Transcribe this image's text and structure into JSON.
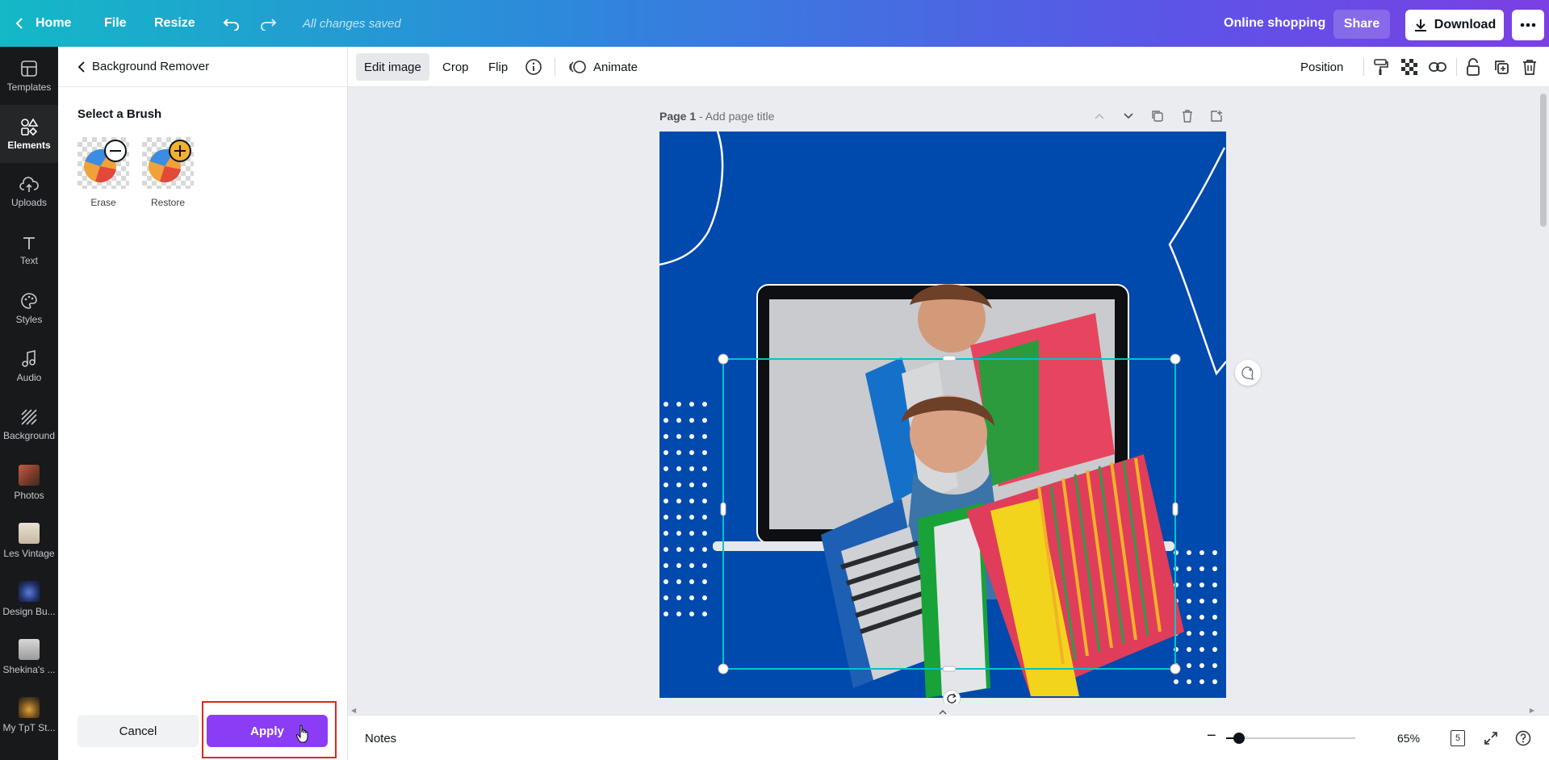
{
  "topbar": {
    "home_label": "Home",
    "file_label": "File",
    "resize_label": "Resize",
    "status": "All changes saved",
    "project_title": "Online shopping",
    "share_label": "Share",
    "download_label": "Download",
    "icons": [
      "chevron-left-icon",
      "undo-icon",
      "redo-icon",
      "download-icon",
      "more-icon"
    ],
    "gradient_colors": [
      "#14b8c6",
      "#2f86dc",
      "#5b55e6",
      "#7b3fe4"
    ]
  },
  "rail": {
    "items": [
      {
        "label": "Templates",
        "icon": "templates-icon"
      },
      {
        "label": "Elements",
        "icon": "elements-icon",
        "active": true
      },
      {
        "label": "Uploads",
        "icon": "upload-cloud-icon"
      },
      {
        "label": "Text",
        "icon": "text-icon"
      },
      {
        "label": "Styles",
        "icon": "palette-icon"
      },
      {
        "label": "Audio",
        "icon": "music-note-icon"
      },
      {
        "label": "Background",
        "icon": "background-hatch-icon"
      },
      {
        "label": "Photos",
        "icon": "photos-thumb"
      },
      {
        "label": "Les Vintage",
        "icon": "folder-thumb"
      },
      {
        "label": "Design Bu...",
        "icon": "folder-thumb"
      },
      {
        "label": "Shekina's ...",
        "icon": "folder-thumb"
      },
      {
        "label": "My TpT St...",
        "icon": "folder-thumb"
      }
    ]
  },
  "panel": {
    "back_label": "Background Remover",
    "section_title": "Select a Brush",
    "brushes": [
      {
        "label": "Erase",
        "icon": "minus-circle-icon"
      },
      {
        "label": "Restore",
        "icon": "plus-circle-icon"
      }
    ],
    "cancel_label": "Cancel",
    "apply_label": "Apply",
    "apply_button_color": "#8b3df5",
    "highlight_color": "#e1251b"
  },
  "toolbar": {
    "edit_image_label": "Edit image",
    "crop_label": "Crop",
    "flip_label": "Flip",
    "animate_label": "Animate",
    "position_label": "Position",
    "right_icons": [
      "paint-roller-icon",
      "transparency-icon",
      "link-icon",
      "lock-icon",
      "duplicate-icon",
      "trash-icon"
    ]
  },
  "canvas": {
    "page_label": "Page 1",
    "page_title_placeholder": "- Add page title",
    "design_bg": "#0049ad",
    "selection_color": "#00c4cc"
  },
  "bottombar": {
    "notes_label": "Notes",
    "zoom_value": "65%",
    "zoom_fraction": 0.1,
    "page_count": "5"
  }
}
